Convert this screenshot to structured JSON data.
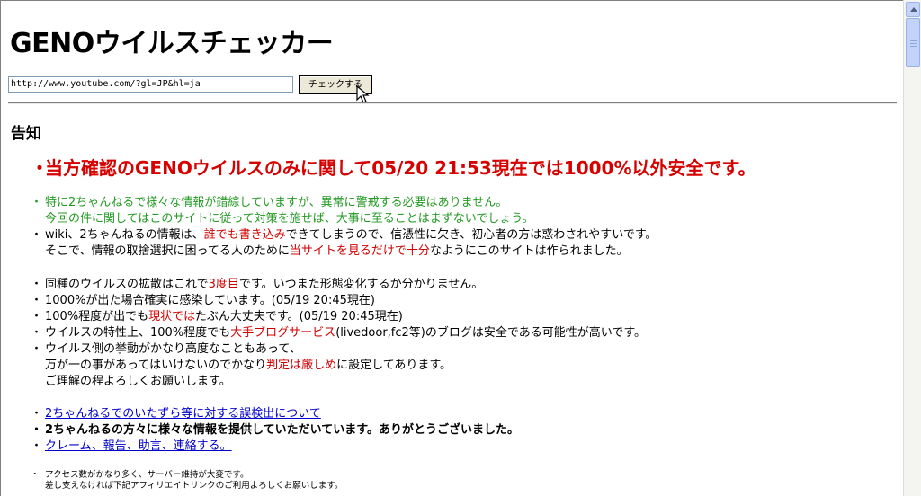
{
  "page": {
    "title": "GENOウイルスチェッカー"
  },
  "form": {
    "url_value": "http://www.youtube.com/?gl=JP&hl=ja",
    "check_button": "チェックする"
  },
  "notice": {
    "heading": "告知",
    "headline": "当方確認のGENOウイルスのみに関して05/20 21:53現在では1000%以外安全です。",
    "group1": [
      {
        "lines": [
          "特に2ちゃんねるで様々な情報が錯綜していますが、異常に警戒する必要はありません。",
          "今回の件に関してはこのサイトに従って対策を施せば、大事に至ることはまずないでしょう。"
        ]
      }
    ],
    "wiki_line1_a": "wiki、2ちゃんねるの情報は、",
    "wiki_line1_b": "誰でも書き込み",
    "wiki_line1_c": "できてしまうので、信憑性に欠き、初心者の方は惑わされやすいです。",
    "wiki_line2_a": "そこで、情報の取捨選択に困ってる人のために",
    "wiki_line2_b": "当サイトを見るだけで十分",
    "wiki_line2_c": "なようにこのサイトは作られました。",
    "spread_a": "同種のウイルスの拡散はこれで",
    "spread_b": "3度目",
    "spread_c": "です。いつまた形態変化するか分かりません。",
    "infect_1000": "1000%が出た場合確実に感染しています。(05/19 20:45現在)",
    "p100_a": "100%程度が出でも",
    "p100_b": "現状では",
    "p100_c": "たぶん大丈夫です。(05/19 20:45現在)",
    "trait_a": "ウイルスの特性上、100%程度でも",
    "trait_b": "大手ブログサービス",
    "trait_c": "(livedoor,fc2等)のブログは安全である可能性が高いです。",
    "adv_line1": "ウイルス側の挙動がかなり高度なこともあって、",
    "adv_line2_a": "万が一の事があってはいけないのでかなり",
    "adv_line2_b": "判定は厳しめ",
    "adv_line2_c": "に設定してあります。",
    "adv_line3": "ご理解の程よろしくお願いします。",
    "link_false_positive": "2ちゃんねるでのいたずら等に対する誤検出について",
    "thanks": "2ちゃんねるの方々に様々な情報を提供していただいています。ありがとうございました。",
    "link_contact": "クレーム、報告、助言、連絡する。",
    "small_line1": "アクセス数がかなり多く、サーバー維持が大変です。",
    "small_line2": "差し支えなければ下記アフィリエイトリンクのご利用よろしくお願いします。"
  },
  "colors": {
    "warning_red": "#d60000",
    "notice_green": "#229922",
    "link_blue": "#0000cc"
  }
}
